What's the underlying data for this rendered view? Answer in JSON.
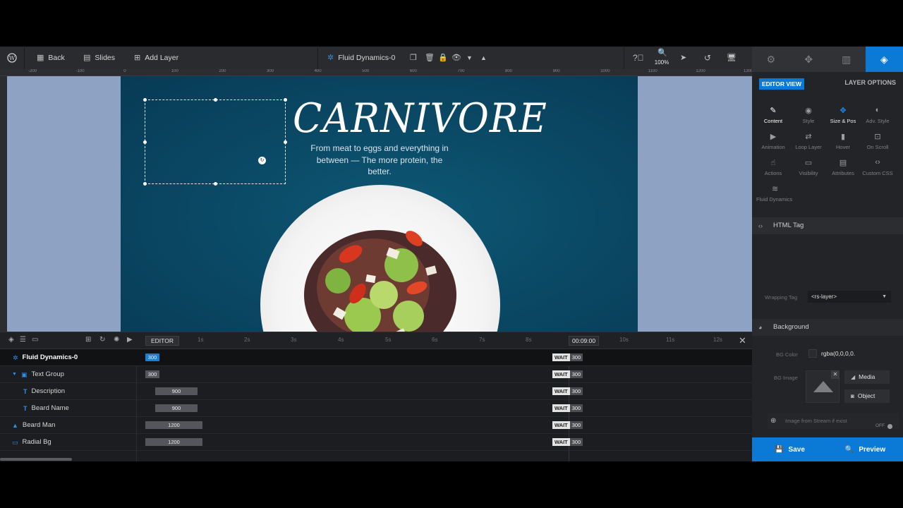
{
  "toolbar": {
    "back": "Back",
    "slides": "Slides",
    "add_layer": "Add Layer",
    "layer_name": "Fluid Dynamics-0",
    "zoom": "100%"
  },
  "ruler": [
    "-200",
    "-100",
    "0",
    "100",
    "200",
    "300",
    "400",
    "500",
    "600",
    "700",
    "800",
    "900",
    "1000",
    "1100",
    "1200",
    "1300"
  ],
  "slide": {
    "title": "CARNIVORE",
    "description": "From meat to eggs and everything in between — The more protein, the better."
  },
  "timeline": {
    "editor_label": "EDITOR",
    "ticks": [
      "1s",
      "2s",
      "3s",
      "4s",
      "5s",
      "6s",
      "7s",
      "8s",
      "10s",
      "11s",
      "12s"
    ],
    "current_time": "00:09:00",
    "rows": [
      {
        "name": "Fluid Dynamics-0",
        "bar": "300",
        "wait": "WAIT",
        "end": "300"
      },
      {
        "name": "Text Group",
        "bar": "300",
        "wait": "WAIT",
        "end": "300"
      },
      {
        "name": "Description",
        "bar": "900",
        "wait": "WAIT",
        "end": "300"
      },
      {
        "name": "Beard Name",
        "bar": "900",
        "wait": "WAIT",
        "end": "300"
      },
      {
        "name": "Beard Man",
        "bar": "1200",
        "wait": "WAIT",
        "end": "300"
      },
      {
        "name": "Radial Bg",
        "bar": "1200",
        "wait": "WAIT",
        "end": "300"
      }
    ]
  },
  "panel": {
    "editor_view": "EDITOR VIEW",
    "layer_options": "LAYER OPTIONS",
    "options": [
      "Content",
      "Style",
      "Size & Pos",
      "Adv. Style",
      "Animation",
      "Loop Layer",
      "Hover",
      "On Scroll",
      "Actions",
      "Visibility",
      "Attributes",
      "Custom CSS",
      "Fluid Dynamics"
    ],
    "html_tag_section": "HTML Tag",
    "wrapping_tag_label": "Wrapping Tag",
    "wrapping_tag_value": "<rs-layer>",
    "background_section": "Background",
    "bg_color_label": "BG Color",
    "bg_color_value": "rgba(0,0,0,0.",
    "bg_image_label": "BG Image",
    "media_label": "Media",
    "object_label": "Object",
    "stream_label": "Image from Stream if exist",
    "stream_toggle": "OFF",
    "save": "Save",
    "preview": "Preview"
  },
  "colors": {
    "accent": "#0b79d6",
    "canvas_bg": "#8ea3c4",
    "stage_bg": "#0a4a66"
  }
}
